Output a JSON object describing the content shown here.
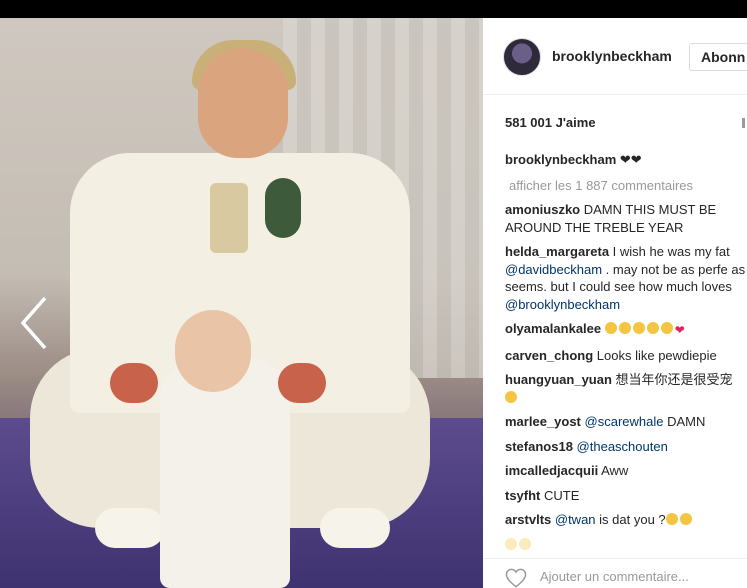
{
  "header": {
    "username": "brooklynbeckham",
    "follow_label": "Abonn"
  },
  "post": {
    "likes": "581 001 J'aime",
    "caption_user": "brooklynbeckham",
    "caption_text": "❤❤",
    "view_all": "afficher les 1 887 commentaires"
  },
  "comments": [
    {
      "user": "amoniuszko",
      "text": " DAMN THIS MUST BE AROUND THE TREBLE YEAR"
    },
    {
      "user": "helda_margareta",
      "text_a": " I wish he was my fat",
      "mention": "@davidbeckham",
      "text_b": " . may not be as perfe as it seems. but I could see how much loves ",
      "mention2": "@brooklynbeckham"
    },
    {
      "user": "olyamalankalee",
      "text": ""
    },
    {
      "user": "carven_chong",
      "text": " Looks like pewdiepie"
    },
    {
      "user": "huangyuan_yuan",
      "text": " 想当年你还是很受宠"
    },
    {
      "user": "marlee_yost",
      "mention": "@scarewhale",
      "text": " DAMN"
    },
    {
      "user": "stefanos18",
      "mention": "@theaschouten",
      "text": ""
    },
    {
      "user": "imcalledjacquii",
      "text": " Aww"
    },
    {
      "user": "tsyfht",
      "text": " CUTE"
    },
    {
      "user": "arstvlts",
      "mention": "@twan",
      "text": " is dat you ?"
    }
  ],
  "footer": {
    "add_comment_placeholder": "Ajouter un commentaire..."
  },
  "icons": {
    "prev": "chevron-left-icon",
    "like": "heart-outline-icon"
  }
}
